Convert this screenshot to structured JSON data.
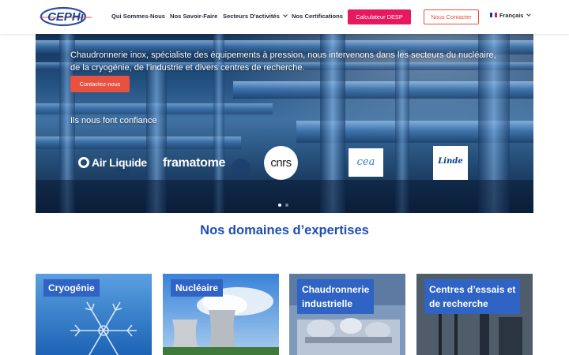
{
  "header": {
    "logo_text": "CEPHi",
    "nav": [
      {
        "label": "Qui Sommes-Nous"
      },
      {
        "label": "Nos Savoir-Faire"
      },
      {
        "label": "Secteurs D'activités"
      },
      {
        "label": "Nos Certifications"
      }
    ],
    "calc_button": "Calculateur DESP",
    "contact_button": "Nous Contacter",
    "language": "Français"
  },
  "hero": {
    "description": "Chaudronnerie inox, spécialiste des équipements à pression, nous intervenons dans les secteurs du nucléaire, de la cryogénie, de l’industrie et divers centres de recherche.",
    "cta": "Contactez-nous",
    "trust_title": "Ils nous font confiance",
    "partners": [
      "Air Liquide",
      "framatome",
      "cnrs",
      "cea",
      "Linde"
    ],
    "slides_total": 2,
    "slide_active": 1
  },
  "expertise": {
    "title": "Nos domaines d’expertises",
    "cards": [
      {
        "label": "Cryogénie"
      },
      {
        "label": "Nucléaire"
      },
      {
        "label_line1": "Chaudronnerie",
        "label_line2": "industrielle"
      },
      {
        "label_line1": "Centres d’essais et",
        "label_line2": "de recherche"
      }
    ]
  },
  "colors": {
    "accent_pink": "#e6195e",
    "accent_red": "#e8503f",
    "brand_blue": "#1f4eb4",
    "label_blue": "#2f63c4"
  }
}
